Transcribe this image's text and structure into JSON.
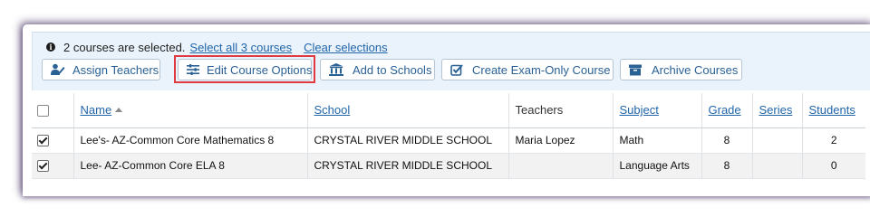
{
  "selection": {
    "message": "2 courses are selected.",
    "select_all": "Select all 3 courses",
    "clear": "Clear selections"
  },
  "actions": {
    "assign_teachers": "Assign Teachers",
    "edit_options": "Edit Course Options",
    "add_to_schools": "Add to Schools",
    "create_exam": "Create Exam-Only Course",
    "archive": "Archive Courses"
  },
  "table": {
    "headers": {
      "name": "Name",
      "school": "School",
      "teachers": "Teachers",
      "subject": "Subject",
      "grade": "Grade",
      "series": "Series",
      "students": "Students"
    },
    "sort": {
      "column": "name",
      "direction": "ascending"
    },
    "rows": [
      {
        "selected": true,
        "name": "Lee's- AZ-Common Core Mathematics 8",
        "school": "CRYSTAL RIVER MIDDLE SCHOOL",
        "teachers": "Maria Lopez",
        "subject": "Math",
        "grade": "8",
        "series": "",
        "students": "2"
      },
      {
        "selected": true,
        "name": "Lee- AZ-Common Core ELA 8",
        "school": "CRYSTAL RIVER MIDDLE SCHOOL",
        "teachers": "",
        "subject": "Language Arts",
        "grade": "8",
        "series": "",
        "students": "0"
      }
    ]
  },
  "colors": {
    "link": "#2266aa",
    "button_text": "#2a6195",
    "highlight": "#e0393f",
    "panel_bg": "#eaf3fb"
  }
}
